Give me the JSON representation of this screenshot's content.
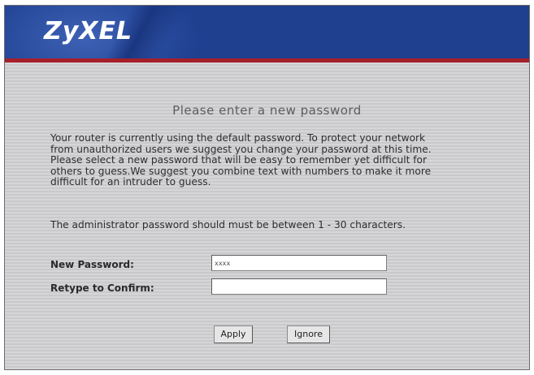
{
  "header": {
    "logo_text": "ZyXEL",
    "brand_color": "#1f3f8f",
    "stripe_color": "#a5202a"
  },
  "main": {
    "title": "Please enter a new password",
    "description_lines": [
      "Your router is currently using the default password. To protect your network",
      "from unauthorized users we suggest you change your password at this time.",
      "Please select a new password that will be easy to remember yet difficult for",
      "others to guess.We suggest you combine text with numbers to make it more",
      "difficult for an intruder to guess."
    ],
    "length_note": "The administrator password should must be between 1 - 30 characters."
  },
  "form": {
    "new_password_label": "New Password:",
    "new_password_value": "xxxx",
    "retype_label": "Retype to Confirm:",
    "retype_value": ""
  },
  "buttons": {
    "apply_label": "Apply",
    "ignore_label": "Ignore"
  }
}
